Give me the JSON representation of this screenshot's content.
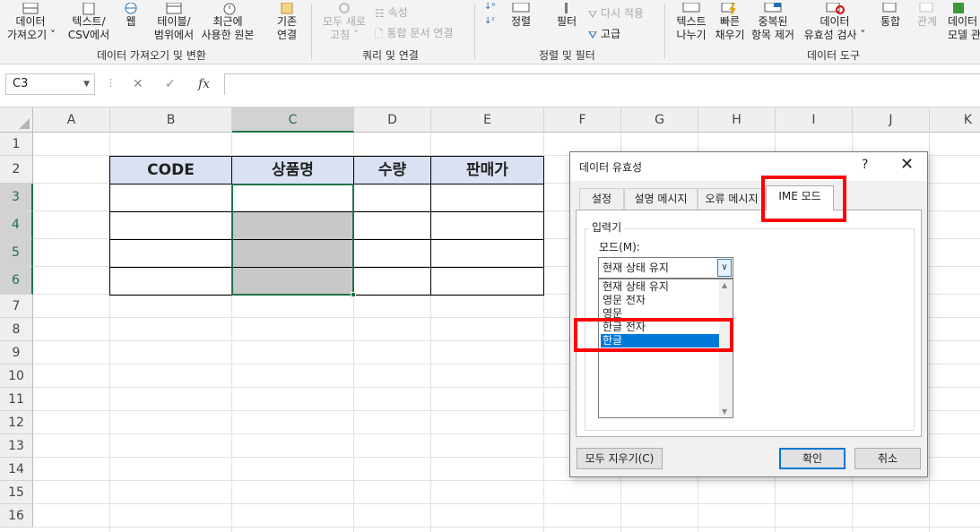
{
  "ribbon": {
    "groups": [
      {
        "label": "데이터 가져오기 및 변환",
        "buttons": [
          {
            "line1": "데이터",
            "line2": "가져오기 ˅"
          },
          {
            "line1": "텍스트/",
            "line2": "CSV에서"
          },
          {
            "line1": "웹",
            "line2": ""
          },
          {
            "line1": "테이블/",
            "line2": "범위에서"
          },
          {
            "line1": "최근에",
            "line2": "사용한 원본"
          },
          {
            "line1": "기존",
            "line2": "연결"
          }
        ]
      },
      {
        "label": "쿼리 및 연결",
        "buttons": [
          {
            "line1": "모두 새로",
            "line2": "고침 ˅"
          },
          {
            "line1": "속성",
            "line2": ""
          },
          {
            "line1": "통합 문서 연결",
            "line2": ""
          }
        ]
      },
      {
        "label": "정렬 및 필터",
        "buttons": [
          {
            "line1": "정렬",
            "line2": ""
          },
          {
            "line1": "필터",
            "line2": ""
          },
          {
            "line1": "다시 적용",
            "line2": ""
          },
          {
            "line1": "고급",
            "line2": ""
          }
        ]
      },
      {
        "label": "데이터 도구",
        "buttons": [
          {
            "line1": "텍스트",
            "line2": "나누기"
          },
          {
            "line1": "빠른",
            "line2": "채우기"
          },
          {
            "line1": "중복된",
            "line2": "항목 제거"
          },
          {
            "line1": "데이터",
            "line2": "유효성 검사 ˅"
          },
          {
            "line1": "통합",
            "line2": ""
          },
          {
            "line1": "관계",
            "line2": ""
          },
          {
            "line1": "데이터",
            "line2": "모델 관"
          }
        ]
      }
    ]
  },
  "formula_bar": {
    "name_box": "C3",
    "fx_label": "fx",
    "value": ""
  },
  "sheet": {
    "columns": [
      "A",
      "B",
      "C",
      "D",
      "E",
      "F",
      "G",
      "H",
      "I",
      "J",
      "K"
    ],
    "rows": [
      "1",
      "2",
      "3",
      "4",
      "5",
      "6",
      "7",
      "8",
      "9",
      "10",
      "11",
      "12",
      "13",
      "14",
      "15",
      "16"
    ],
    "selected_column": "C",
    "table_headers": [
      "CODE",
      "상품명",
      "수량",
      "판매가"
    ]
  },
  "dialog": {
    "title": "데이터 유효성",
    "help": "?",
    "close": "✕",
    "tabs": [
      "설정",
      "설명 메시지",
      "오류 메시지",
      "IME 모드"
    ],
    "active_tab": "IME 모드",
    "group_title": "입력기",
    "mode_label": "모드(M):",
    "mode_value": "현재 상태 유지",
    "options": [
      "현재 상태 유지",
      "영문 전자",
      "영문",
      "한글 전자",
      "한글"
    ],
    "selected_option": "한글",
    "clear_all": "모두 지우기(C)",
    "ok": "확인",
    "cancel": "취소"
  },
  "colors": {
    "excel_green": "#217346",
    "table_header_bg": "#d9e1f2",
    "highlight_red": "#ff0000",
    "selection_blue": "#0078d7"
  }
}
